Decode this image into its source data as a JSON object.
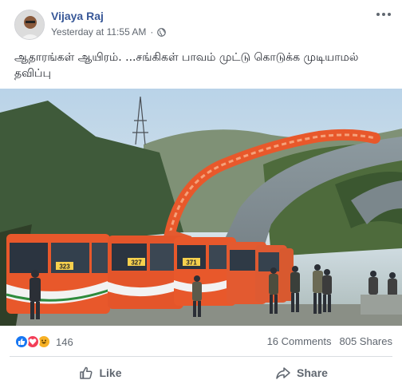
{
  "post": {
    "author": "Vijaya Raj",
    "timestamp": "Yesterday at 11:55 AM",
    "separator": "·",
    "privacy_icon": "globe-icon",
    "text": "ஆதாரங்கள் ஆயிரம். ...சங்கிகள் பாவம் முட்டு கொடுக்க முடியாமல் தவிப்பு"
  },
  "photo": {
    "bus_route_labels": [
      "323",
      "327",
      "371"
    ]
  },
  "stats": {
    "reactions": [
      "like",
      "love",
      "haha"
    ],
    "reaction_count": "146",
    "comments": "16 Comments",
    "shares": "805 Shares"
  },
  "actions": {
    "like_label": "Like",
    "share_label": "Share"
  },
  "colors": {
    "author_link": "#385898",
    "meta_gray": "#606770",
    "like_blue": "#1877f2",
    "love_red": "#f33e58",
    "haha_yellow": "#f7b125",
    "bus_orange": "#e8582b"
  }
}
